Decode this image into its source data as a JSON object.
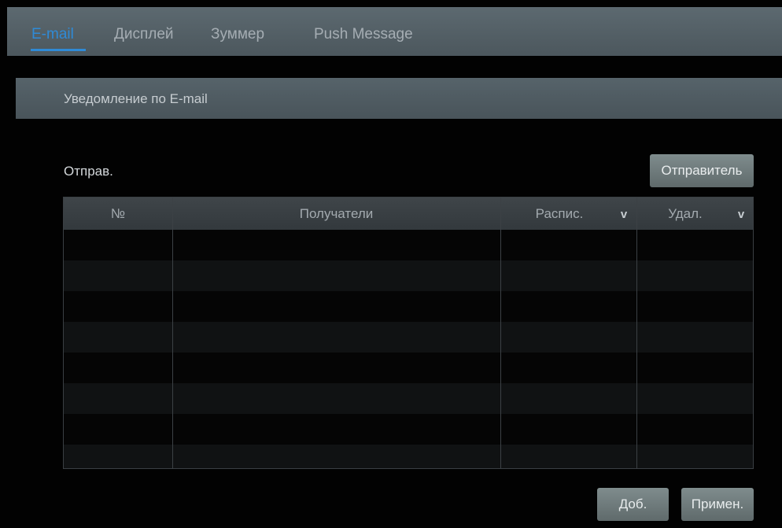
{
  "tabs": [
    {
      "label": "E-mail",
      "active": true
    },
    {
      "label": "Дисплей",
      "active": false
    },
    {
      "label": "Зуммер",
      "active": false
    },
    {
      "label": "Push Message",
      "active": false
    }
  ],
  "section": {
    "title": "Уведомление по E-mail"
  },
  "sender": {
    "label": "Отправ.",
    "button_label": "Отправитель"
  },
  "table": {
    "headers": {
      "number": "№",
      "recipients": "Получатели",
      "schedule": "Распис.",
      "delete": "Удал."
    },
    "dropdown_icon": "v",
    "rows": []
  },
  "actions": {
    "add_label": "Доб.",
    "apply_label": "Примен."
  },
  "colors": {
    "accent": "#2f8ad6",
    "tabbar": "#56636a",
    "button": "#6f7b7c",
    "background": "#020202"
  }
}
